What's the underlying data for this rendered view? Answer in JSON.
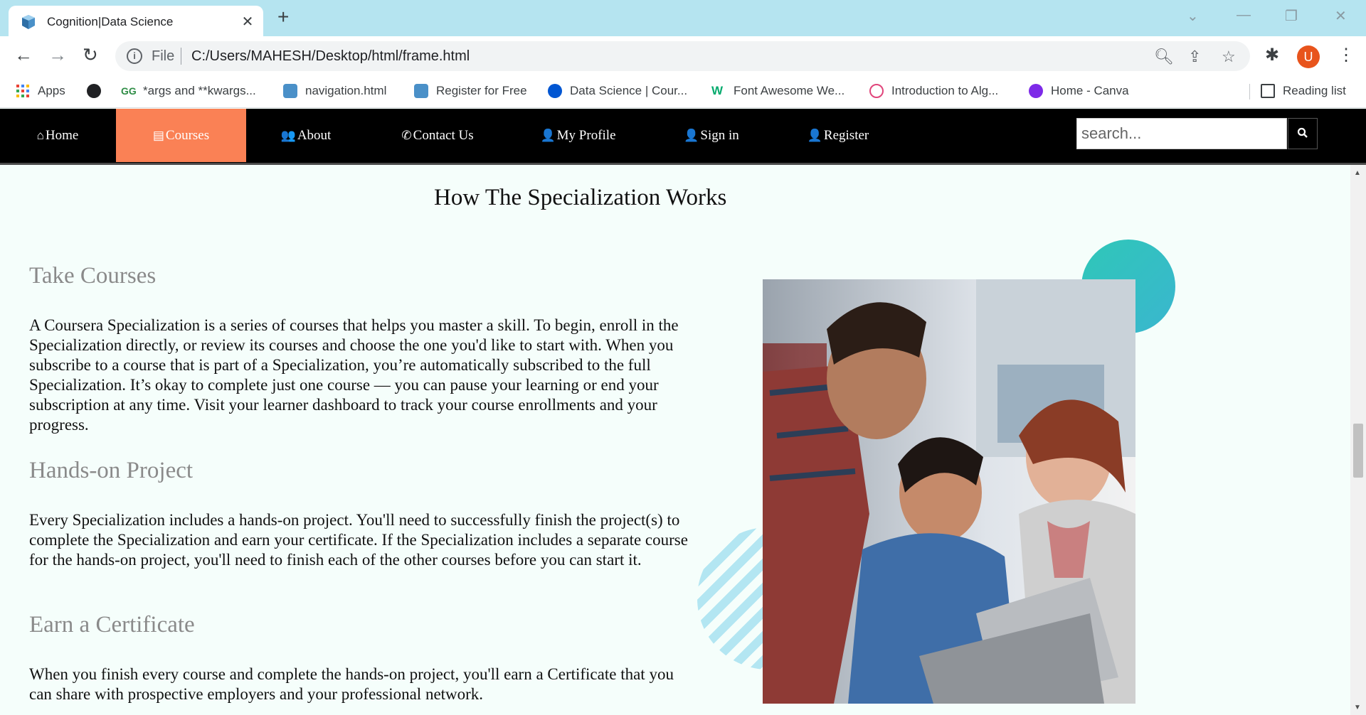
{
  "browser": {
    "tab_title": "Cognition|Data Science",
    "tab_close": "✕",
    "new_tab": "+",
    "file_label": "File",
    "url": "C:/Users/MAHESH/Desktop/html/frame.html",
    "avatar_letter": "U",
    "bookmarks": [
      {
        "label": "Apps",
        "icon": "apps-grid-icon",
        "color": "#4285f4"
      },
      {
        "label": "",
        "icon": "globe-icon",
        "color": "#202124"
      },
      {
        "label": "*args and **kwargs...",
        "icon": "geeksforgeeks-icon",
        "color": "#2f8d46"
      },
      {
        "label": "navigation.html",
        "icon": "html-file-icon",
        "color": "#4a90c8"
      },
      {
        "label": "Register for Free",
        "icon": "html-file-icon",
        "color": "#4a90c8"
      },
      {
        "label": "Data Science | Cour...",
        "icon": "coursera-icon",
        "color": "#0056d2"
      },
      {
        "label": "Font Awesome We...",
        "icon": "w3schools-icon",
        "color": "#04aa6d"
      },
      {
        "label": "Introduction to Alg...",
        "icon": "fingerprint-icon",
        "color": "#e0457b"
      },
      {
        "label": "Home - Canva",
        "icon": "canva-icon",
        "color": "#7d2ae8"
      }
    ],
    "reading_list": "Reading list"
  },
  "nav": {
    "items": [
      {
        "label": "Home",
        "icon": "home-icon",
        "glyph": "⌂"
      },
      {
        "label": "Courses",
        "icon": "book-icon",
        "glyph": "▤",
        "active": true
      },
      {
        "label": "About",
        "icon": "users-icon",
        "glyph": "👥"
      },
      {
        "label": "Contact Us",
        "icon": "phone-icon",
        "glyph": "✆"
      },
      {
        "label": "My Profile",
        "icon": "user-icon",
        "glyph": "👤"
      },
      {
        "label": "Sign in",
        "icon": "user-plus-icon",
        "glyph": "👤"
      },
      {
        "label": "Register",
        "icon": "user-icon",
        "glyph": "👤"
      }
    ],
    "active_color": "#fa8155",
    "search_placeholder": "search..."
  },
  "main": {
    "heading": "How The Specialization Works",
    "sections": [
      {
        "title": "Take Courses",
        "body": "A Coursera Specialization is a series of courses that helps you master a skill. To begin, enroll in the Specialization directly, or review its courses and choose the one you'd like to start with. When you subscribe to a course that is part of a Specialization, you’re automatically subscribed to the full Specialization. It’s okay to complete just one course — you can pause your learning or end your subscription at any time. Visit your learner dashboard to track your course enrollments and your progress."
      },
      {
        "title": "Hands-on Project",
        "body": "Every Specialization includes a hands-on project. You'll need to successfully finish the project(s) to complete the Specialization and earn your certificate. If the Specialization includes a separate course for the hands-on project, you'll need to finish each of the other courses before you can start it."
      },
      {
        "title": "Earn a Certificate",
        "body": "When you finish every course and complete the hands-on project, you'll earn a Certificate that you can share with prospective employers and your professional network."
      }
    ]
  }
}
